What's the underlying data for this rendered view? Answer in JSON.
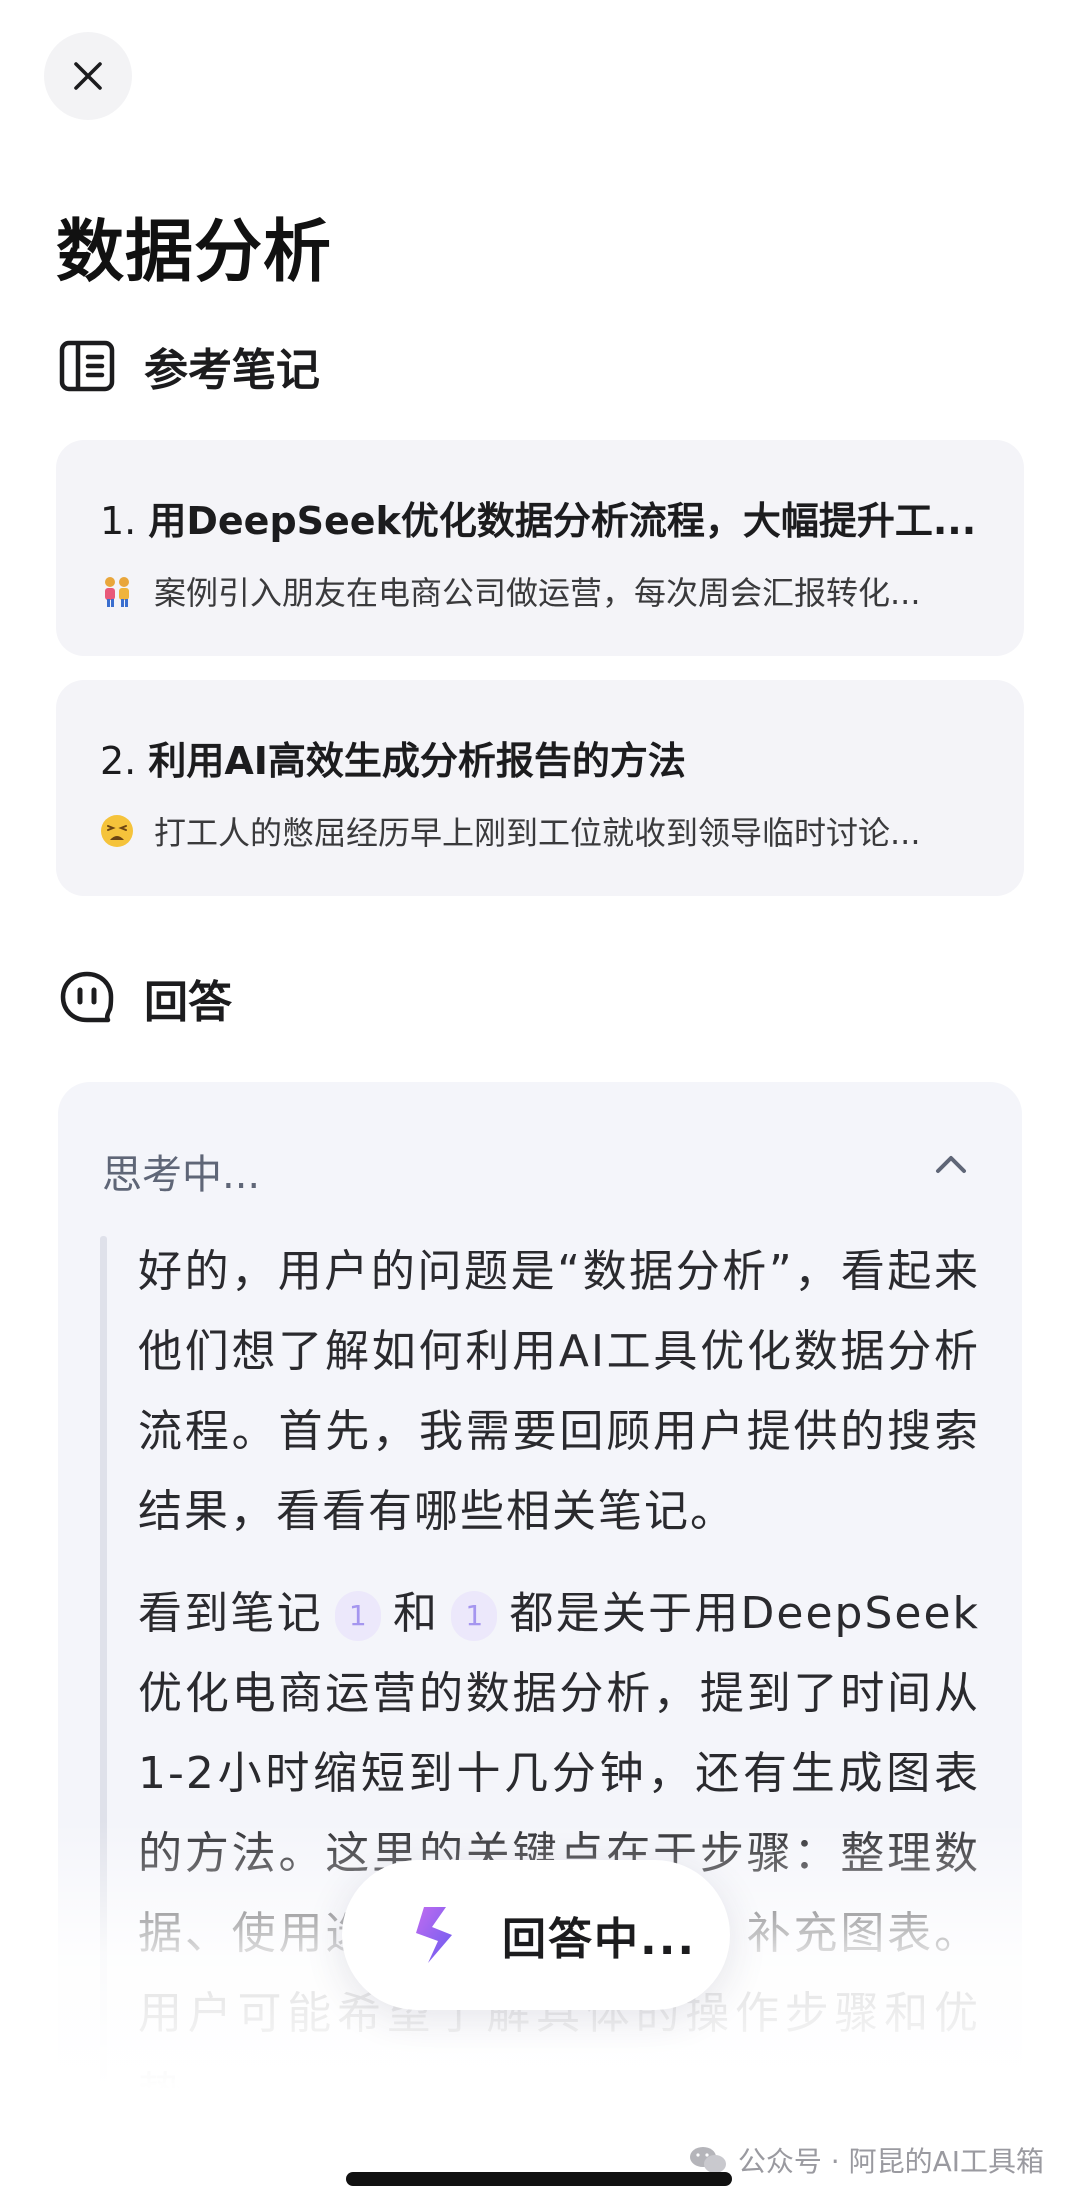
{
  "title": "数据分析",
  "references": {
    "heading": "参考笔记",
    "items": [
      {
        "number": "1.",
        "title": "用DeepSeek优化数据分析流程，大幅提升工...",
        "snippet": "案例引入朋友在电商公司做运营，每次周会汇报转化...",
        "emoji": "couple-emoji"
      },
      {
        "number": "2.",
        "title": "利用AI高效生成分析报告的方法",
        "snippet": "打工人的憋屈经历早上刚到工位就收到领导临时讨论...",
        "emoji": "tired-face-emoji"
      }
    ]
  },
  "answer": {
    "heading": "回答",
    "thinking_label": "思考中...",
    "paragraph1": "好的，用户的问题是“数据分析”，看起来他们想了解如何利用AI工具优化数据分析流程。首先，我需要回顾用户提供的搜索结果，看看有哪些相关笔记。",
    "paragraph2_a": "看到笔记",
    "citation_a": "1",
    "paragraph2_b": "和",
    "citation_b": "1",
    "paragraph2_c": "都是关于用DeepSeek优化电商运营的数据分析，提到了时间从1-2小时缩短到十几分钟，还有生成图表的方法。这里的关键点在于步骤：整理数据、使用选择模型生成报告、补充图表。用户可能希望了解具体的操作步骤和优势。"
  },
  "status": {
    "label": "回答中..."
  },
  "watermark": {
    "text": "公众号 · 阿昆的AI工具箱"
  },
  "colors": {
    "card_bg": "#f4f4f8",
    "citation": "#a596ef",
    "logo_gradient": [
      "#8a6cf2",
      "#c06cf0"
    ]
  }
}
